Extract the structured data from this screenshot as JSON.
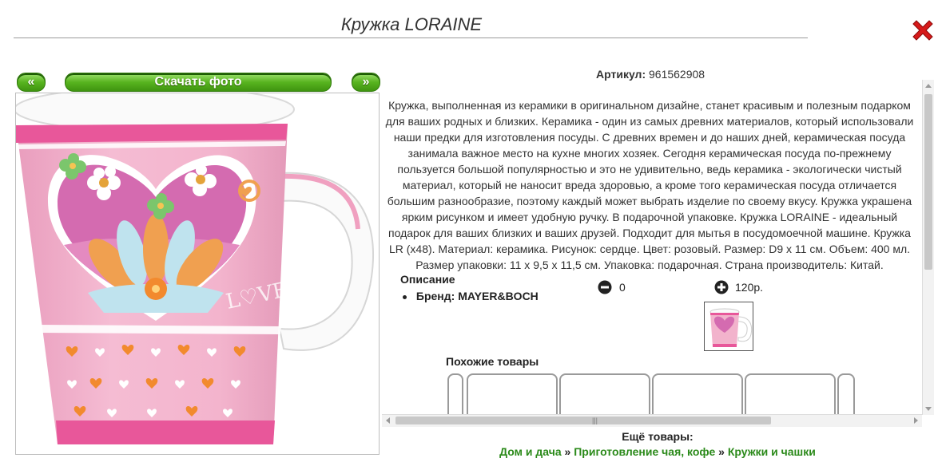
{
  "product": {
    "title": "Кружка LORAINE"
  },
  "gallery": {
    "prev_label": "«",
    "download_label": "Скачать фото",
    "next_label": "»"
  },
  "details": {
    "article_label": "Артикул:",
    "article_value": "961562908",
    "description": "Кружка, выполненная из керамики в оригинальном дизайне, станет красивым и полезным подарком для ваших родных и близких. Керамика - один из самых древних материалов, который использовали наши предки для изготовления посуды. С древних времен и до наших дней, керамическая посуда занимала важное место на кухне многих хозяек. Сегодня керамическая посуда по-прежнему пользуется большой популярностью и это не удивительно, ведь керамика - экологически чистый материал, который не наносит вреда здоровью, а кроме того керамическая посуда отличается большим разнообразие, поэтому каждый может выбрать изделие по своему вкусу. Кружка украшена ярким рисунком и имеет удобную ручку. В подарочной упаковке. Кружка LORAINE - идеальный подарок для ваших близких и ваших друзей. Подходит для мытья в посудомоечной машине. Кружка LR (x48). Материал: керамика. Рисунок: сердце. Цвет: розовый. Размер: D9 x 11 см. Объем: 400 мл. Размер упаковки: 11 x 9,5 x 11,5 см. Упаковка: подарочная. Страна производитель: Китай.",
    "description_heading": "Описание",
    "brand_label": "Бренд:",
    "brand_value": "MAYER&BOCH",
    "minus_value": "0",
    "plus_value": "120р."
  },
  "similar": {
    "title": "Похожие товары"
  },
  "more": {
    "title": "Ещё товары:",
    "breadcrumb": [
      {
        "label": "Дом и дача"
      },
      {
        "label": "Приготовление чая, кофе"
      },
      {
        "label": "Кружки и чашки"
      }
    ],
    "separator": "»"
  },
  "colors": {
    "mug_pink": "#f2b3cc",
    "mug_deep_pink": "#e8579a",
    "button_green": "#58b41f",
    "link_green": "#2b8a1a",
    "close_red": "#d61a1a"
  },
  "icons": {
    "close": "close-icon",
    "minus": "minus-circle-icon",
    "plus": "plus-circle-icon"
  }
}
